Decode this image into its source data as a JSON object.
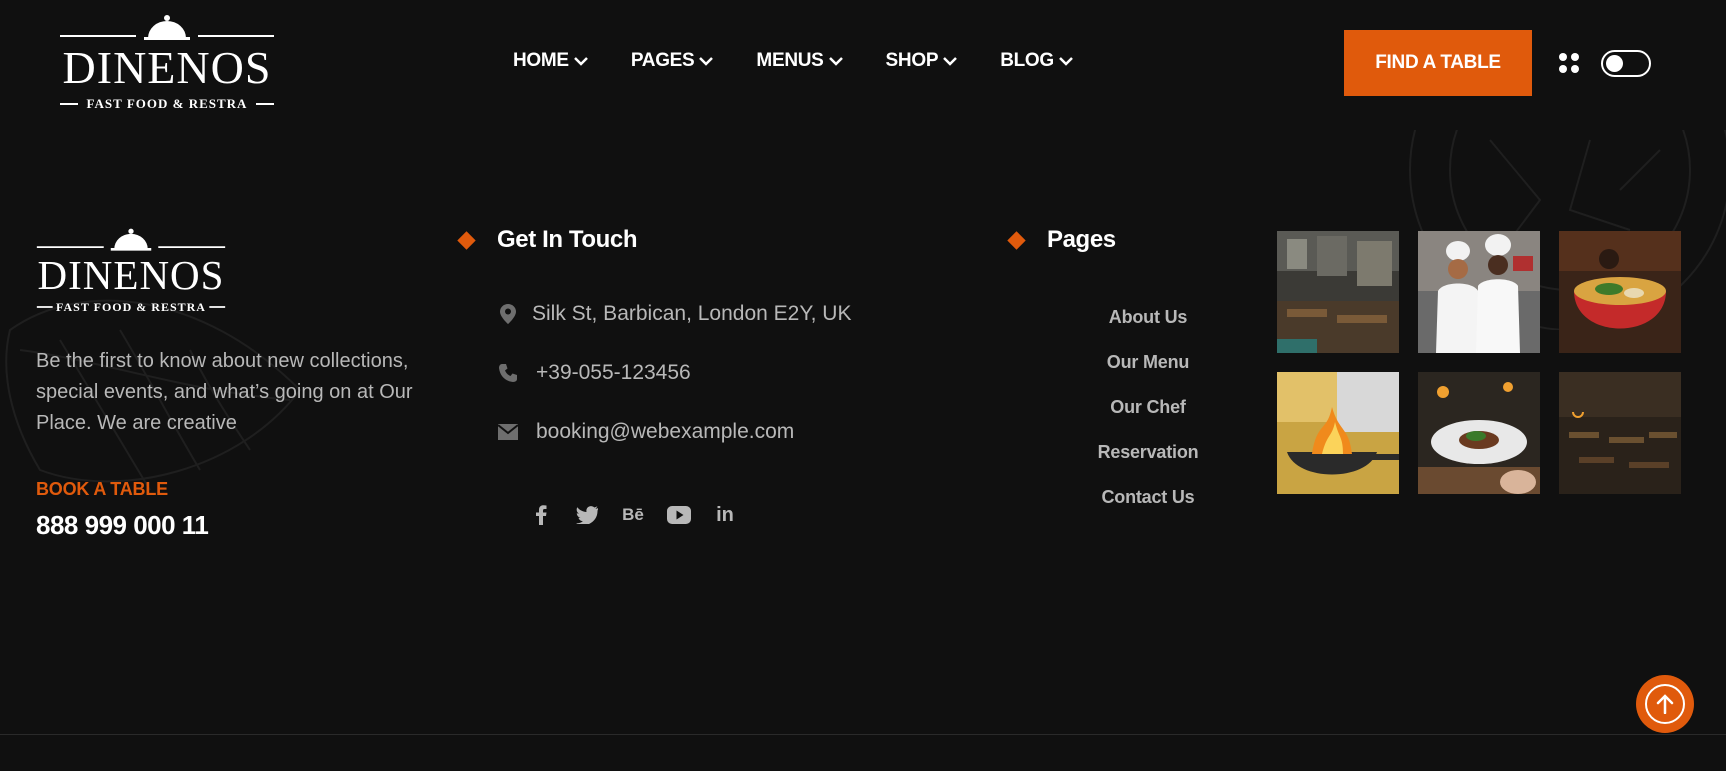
{
  "brand": {
    "name": "DINENOS",
    "tagline": "FAST FOOD & RESTRA"
  },
  "nav": {
    "items": [
      {
        "label": "HOME"
      },
      {
        "label": "PAGES"
      },
      {
        "label": "MENUS"
      },
      {
        "label": "SHOP"
      },
      {
        "label": "BLOG"
      }
    ],
    "cta_label": "FIND A TABLE"
  },
  "footer": {
    "about": "Be the first to know about new collections, special events, and what’s going on at Our Place. We are creative",
    "book_label": "BOOK A TABLE",
    "phone": "888 999 000 11",
    "contact": {
      "heading": "Get In Touch",
      "address": "Silk St, Barbican, London E2Y, UK",
      "phone": "+39-055-123456",
      "email": "booking@webexample.com"
    },
    "social": [
      {
        "icon": "facebook-icon",
        "glyph": "f"
      },
      {
        "icon": "twitter-icon",
        "glyph": ""
      },
      {
        "icon": "behance-icon",
        "glyph": "Bē"
      },
      {
        "icon": "youtube-icon",
        "glyph": ""
      },
      {
        "icon": "linkedin-icon",
        "glyph": "in"
      }
    ],
    "pages": {
      "heading": "Pages",
      "links": [
        "About Us",
        "Our Menu",
        "Our Chef",
        "Reservation",
        "Contact Us"
      ]
    },
    "gallery": [
      "restaurant-interior",
      "chefs",
      "ramen-bowl",
      "flambe-pan",
      "plated-dish",
      "dining-hall"
    ]
  },
  "colors": {
    "accent": "#e05a0c",
    "background": "#101010",
    "muted_text": "#b8b8b8"
  }
}
